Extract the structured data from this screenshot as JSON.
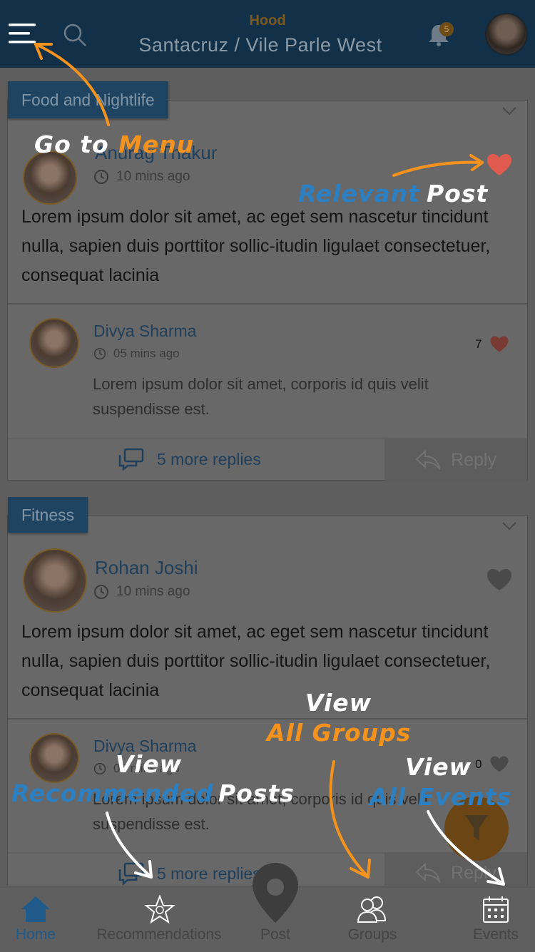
{
  "header": {
    "hood_label": "Hood",
    "location": "Santacruz / Vile Parle West",
    "notification_count": "5"
  },
  "posts": [
    {
      "category": "Food and Nightlife",
      "author": "Anurag Thakur",
      "time": "10 mins ago",
      "text": "Lorem ipsum dolor sit amet, ac eget sem nascetur tincidunt nulla, sapien duis porttitor sollic-itudin ligulaet consectetuer, consequat lacinia",
      "liked": true,
      "reply": {
        "author": "Divya Sharma",
        "time": "05 mins ago",
        "text": "Lorem ipsum dolor sit amet, corporis id quis velit suspendisse est.",
        "likes": "7"
      },
      "more_replies": "5 more replies",
      "reply_label": "Reply"
    },
    {
      "category": "Fitness",
      "author": "Rohan Joshi",
      "time": "10 mins ago",
      "text": "Lorem ipsum dolor sit amet, ac eget sem nascetur tincidunt nulla, sapien duis porttitor sollic-itudin ligulaet consectetuer, consequat lacinia",
      "liked": false,
      "reply": {
        "author": "Divya Sharma",
        "time": "05 mins ago",
        "text": "Lorem ipsum dolor sit amet, corporis id quis velit suspendisse est.",
        "likes": "0"
      },
      "more_replies": "5 more replies",
      "reply_label": "Reply"
    }
  ],
  "bottom_nav": {
    "home": "Home",
    "recommendations": "Recommendations",
    "post": "Post",
    "groups": "Groups",
    "events": "Events"
  },
  "annotations": {
    "menu": [
      "Go to",
      "Menu"
    ],
    "relevant": [
      "Relevant",
      "Post"
    ],
    "groups": [
      "View",
      "All Groups"
    ],
    "recommended": [
      "View",
      "Recommended",
      "Posts"
    ],
    "events": [
      "View",
      "All",
      "Events"
    ]
  },
  "colors": {
    "header_bg": "#123148",
    "accent_blue": "#2c7fc0",
    "accent_orange": "#f4921e",
    "liked_heart": "#e05a4f",
    "home_active": "#1f5a8a"
  }
}
